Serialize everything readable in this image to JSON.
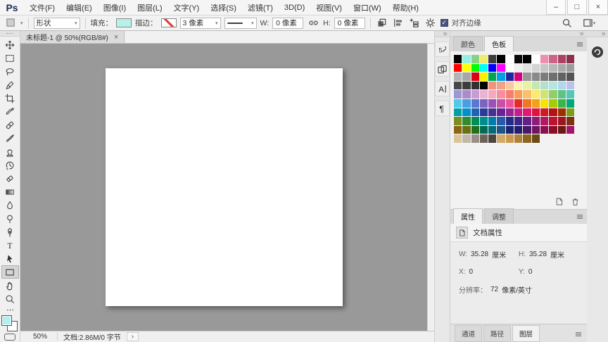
{
  "titlebar": {
    "logo": "Ps",
    "menus": [
      "文件(F)",
      "编辑(E)",
      "图像(I)",
      "图层(L)",
      "文字(Y)",
      "选择(S)",
      "滤镜(T)",
      "3D(D)",
      "视图(V)",
      "窗口(W)",
      "帮助(H)"
    ],
    "window_controls": {
      "minimize": "–",
      "maximize": "□",
      "close": "×"
    }
  },
  "options_bar": {
    "shape_mode": "形状",
    "fill_label": "填充：",
    "fill_color": "#b7f1e9",
    "stroke_label": "描边：",
    "stroke_width": "3 像素",
    "w_label": "W:",
    "w_value": "0 像素",
    "h_label": "H:",
    "h_value": "0 像素",
    "align_edges_label": "对齐边缘",
    "align_edges_checked": "✓"
  },
  "toolbar": {
    "tools": [
      "move-tool",
      "marquee-tool",
      "lasso-tool",
      "quick-selection-tool",
      "crop-tool",
      "eyedropper-tool",
      "healing-brush-tool",
      "brush-tool",
      "clone-stamp-tool",
      "history-brush-tool",
      "eraser-tool",
      "gradient-tool",
      "blur-tool",
      "dodge-tool",
      "pen-tool",
      "type-tool",
      "path-selection-tool",
      "rectangle-tool",
      "hand-tool",
      "zoom-tool"
    ],
    "selected_tool": "rectangle-tool",
    "foreground_color": "#abf3ee",
    "background_color": "#ffffff"
  },
  "document": {
    "tab_title": "未标题-1 @ 50%(RGB/8#)",
    "close_glyph": "×",
    "workspace_color": "#999999",
    "page_color": "#ffffff"
  },
  "status_bar": {
    "zoom_level": "50%",
    "doc_info": "文档:2.86M/0 字节",
    "expand_glyph": "›"
  },
  "dock_icons": [
    "history-panel",
    "clone-source-panel",
    "character-panel",
    "paragraph-panel"
  ],
  "panels": {
    "swatches": {
      "tabs": [
        "颜色",
        "色板"
      ],
      "active_tab": "色板",
      "rows": [
        [
          "#000000",
          "#93efe3",
          "#8ecf88",
          "#f2e96d",
          "#3c3c3c",
          "#000000",
          "#ffffff",
          "#0a0a0a",
          "#000000",
          "#ffffff",
          "#ee8fb0",
          "#cb6488",
          "#ad4063",
          "#8e2f4d"
        ],
        [
          "#fe0000",
          "#ffff00",
          "#00ff01",
          "#00ffff",
          "#0000fe",
          "#ff00ff",
          "#ffffff",
          "#f0f0f0",
          "#e2e2e2",
          "#d4d4d4",
          "#c6c6c6",
          "#b8b8b8",
          "#aaaaaa",
          "#9c9c9c"
        ],
        [
          "#b4b4b4",
          "#a6a6a6",
          "#df0011",
          "#f6f200",
          "#00a650",
          "#00a0e3",
          "#22269e",
          "#d5007f",
          "#989898",
          "#8a8a8a",
          "#7c7c7c",
          "#6f6f6f",
          "#616161",
          "#545454"
        ],
        [
          "#484848",
          "#3d3d3d",
          "#323232",
          "#000000",
          "#f1947b",
          "#f3a285",
          "#f8c89e",
          "#fcf2ae",
          "#e8f1a5",
          "#c4e8b2",
          "#b2e2cc",
          "#b6e5e1",
          "#b1d7ee",
          "#bdc2e8"
        ],
        [
          "#9a98d1",
          "#ab8cc9",
          "#c99cd3",
          "#e9b3d4",
          "#f7a8c1",
          "#f78d9e",
          "#f87d6f",
          "#f99d56",
          "#fbc168",
          "#fdea6c",
          "#cee56f",
          "#8ed06c",
          "#5ec385",
          "#54c8b7"
        ],
        [
          "#4fc8e9",
          "#4a9de2",
          "#5b77d1",
          "#7b64c1",
          "#9b50b9",
          "#c950a9",
          "#e9559b",
          "#e92a2c",
          "#f07822",
          "#f5a01b",
          "#f5e500",
          "#a8cc04",
          "#3cb44b",
          "#00a877"
        ],
        [
          "#00a0a4",
          "#0091cb",
          "#2162b2",
          "#2a3a98",
          "#47308f",
          "#6a2397",
          "#9a2394",
          "#c51d8b",
          "#e01a71",
          "#e01243",
          "#d11a24",
          "#b31312",
          "#9d3000",
          "#7ca015"
        ],
        [
          "#7b8c20",
          "#2f8c30",
          "#008d5b",
          "#008d8d",
          "#007dab",
          "#2959ab",
          "#212d89",
          "#3d2589",
          "#651f89",
          "#8d1d79",
          "#b21962",
          "#bd1232",
          "#9d1522",
          "#7d3212"
        ],
        [
          "#8a6512",
          "#6a7112",
          "#1f711f",
          "#006b51",
          "#006b79",
          "#1d5589",
          "#192572",
          "#251d72",
          "#491969",
          "#711561",
          "#8d1152",
          "#8d0d29",
          "#6d1911",
          "#a2156a"
        ],
        [
          "#d9c59b",
          "#c1b9a9",
          "#999189",
          "#6b6359",
          "#4b453d",
          "#d1a969",
          "#c99951",
          "#b18139",
          "#8d6521",
          "#6b4b15"
        ]
      ]
    },
    "properties": {
      "tabs": [
        "属性",
        "调整"
      ],
      "active_tab": "属性",
      "header": "文档属性",
      "fields": {
        "w_label": "W:",
        "w_value": "35.28",
        "w_unit": "厘米",
        "h_label": "H:",
        "h_value": "35.28",
        "h_unit": "厘米",
        "x_label": "X:",
        "x_value": "0",
        "y_label": "Y:",
        "y_value": "0",
        "resolution_label": "分辨率：",
        "resolution_value": "72",
        "resolution_unit": "像素/英寸"
      }
    },
    "bottom_tabs": {
      "tabs": [
        "通道",
        "路径",
        "图层"
      ],
      "active_tab": "图层"
    }
  }
}
